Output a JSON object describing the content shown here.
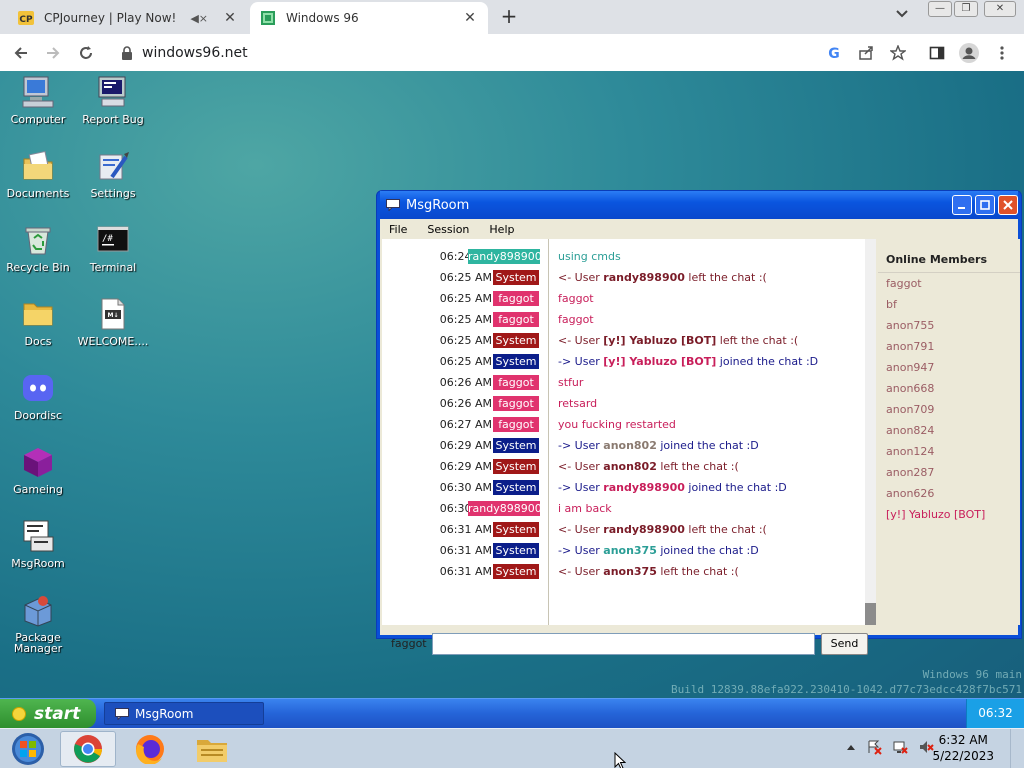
{
  "browser": {
    "tabs": [
      {
        "title": "CPJourney | Play Now!",
        "favicon": "cpjourney-icon",
        "muted": true,
        "active": false
      },
      {
        "title": "Windows 96",
        "favicon": "windows96-icon",
        "active": true
      }
    ],
    "new_tab_label": "+",
    "url": "windows96.net",
    "window_controls": [
      "minimize",
      "restore",
      "close"
    ]
  },
  "desktop": {
    "icons": [
      {
        "label": "Computer",
        "icon": "computer-icon"
      },
      {
        "label": "Report Bug",
        "icon": "report-bug-icon"
      },
      {
        "label": "Documents",
        "icon": "documents-icon"
      },
      {
        "label": "Settings",
        "icon": "settings-icon"
      },
      {
        "label": "Recycle Bin",
        "icon": "recycle-bin-icon"
      },
      {
        "label": "Terminal",
        "icon": "terminal-icon"
      },
      {
        "label": "Docs",
        "icon": "folder-icon"
      },
      {
        "label": "WELCOME....",
        "icon": "markdown-file-icon"
      },
      {
        "label": "Doordisc",
        "icon": "doordisc-icon"
      },
      {
        "label": "Gameing",
        "icon": "gameing-icon"
      },
      {
        "label": "MsgRoom",
        "icon": "msgroom-icon"
      },
      {
        "label": "Package Manager",
        "icon": "package-manager-icon"
      }
    ],
    "watermark_line1": "Windows 96 main",
    "watermark_line2": "Build 12839.88efa922.230410-1042.d77c73edcc428f7bc571"
  },
  "msgroom": {
    "title": "MsgRoom",
    "menu": [
      "File",
      "Session",
      "Help"
    ],
    "messages": [
      {
        "time": "06:24 AM",
        "nick": "randy898900",
        "nick_color": "#2eb5a0",
        "text": "using cmds",
        "kind": "chat-teal"
      },
      {
        "time": "06:25 AM",
        "nick": "System",
        "nick_color": "#a01818",
        "text_prefix": "<- User ",
        "user": "randy898900",
        "text_suffix": " left the chat :(",
        "kind": "sys"
      },
      {
        "time": "06:25 AM",
        "nick": "faggot",
        "nick_color": "#e0336e",
        "text": "faggot",
        "kind": "chat"
      },
      {
        "time": "06:25 AM",
        "nick": "faggot",
        "nick_color": "#e0336e",
        "text": "faggot",
        "kind": "chat"
      },
      {
        "time": "06:25 AM",
        "nick": "System",
        "nick_color": "#a01818",
        "text_prefix": "<- User ",
        "user": "[y!] Yabluzo [BOT]",
        "text_suffix": " left the chat :(",
        "kind": "sys"
      },
      {
        "time": "06:25 AM",
        "nick": "System",
        "nick_color": "#0b1e8a",
        "text_prefix": "-> User ",
        "user": "[y!] Yabluzo [BOT]",
        "user_color": "#c81e5a",
        "text_suffix": " joined the chat :D",
        "kind": "sys"
      },
      {
        "time": "06:26 AM",
        "nick": "faggot",
        "nick_color": "#e0336e",
        "text": "stfur",
        "kind": "chat"
      },
      {
        "time": "06:26 AM",
        "nick": "faggot",
        "nick_color": "#e0336e",
        "text": "retsard",
        "kind": "chat"
      },
      {
        "time": "06:27 AM",
        "nick": "faggot",
        "nick_color": "#e0336e",
        "text": "you fucking restarted",
        "kind": "chat"
      },
      {
        "time": "06:29 AM",
        "nick": "System",
        "nick_color": "#0b1e8a",
        "text_prefix": "-> User ",
        "user": "anon802",
        "user_color": "#8a7a70",
        "text_suffix": " joined the chat :D",
        "kind": "sys"
      },
      {
        "time": "06:29 AM",
        "nick": "System",
        "nick_color": "#a01818",
        "text_prefix": "<- User ",
        "user": "anon802",
        "text_suffix": " left the chat :(",
        "kind": "sys"
      },
      {
        "time": "06:30 AM",
        "nick": "System",
        "nick_color": "#0b1e8a",
        "text_prefix": "-> User ",
        "user": "randy898900",
        "user_color": "#c81e5a",
        "text_suffix": " joined the chat :D",
        "kind": "sys"
      },
      {
        "time": "06:30 AM",
        "nick": "randy898900",
        "nick_color": "#e0336e",
        "text": "i am back",
        "kind": "chat"
      },
      {
        "time": "06:31 AM",
        "nick": "System",
        "nick_color": "#a01818",
        "text_prefix": "<- User ",
        "user": "randy898900",
        "text_suffix": " left the chat :(",
        "kind": "sys"
      },
      {
        "time": "06:31 AM",
        "nick": "System",
        "nick_color": "#0b1e8a",
        "text_prefix": "-> User ",
        "user": "anon375",
        "user_color": "#2b9e96",
        "text_suffix": " joined the chat :D",
        "kind": "sys"
      },
      {
        "time": "06:31 AM",
        "nick": "System",
        "nick_color": "#a01818",
        "text_prefix": "<- User ",
        "user": "anon375",
        "text_suffix": " left the chat :(",
        "kind": "sys"
      }
    ],
    "members_header": "Online Members",
    "members": [
      "faggot",
      "bf",
      "anon755",
      "anon791",
      "anon947",
      "anon668",
      "anon709",
      "anon824",
      "anon124",
      "anon287",
      "anon626",
      "[y!] Yabluzo [BOT]"
    ],
    "nickname": "faggot",
    "input_value": "",
    "send_label": "Send"
  },
  "win96_taskbar": {
    "start_label": "start",
    "tasks": [
      {
        "label": "MsgRoom",
        "icon": "msgroom-icon"
      }
    ],
    "clock": "06:32"
  },
  "win7_taskbar": {
    "pinned": [
      "windows-start-icon",
      "chrome-icon",
      "firefox-icon",
      "file-explorer-icon"
    ],
    "time": "6:32 AM",
    "date": "5/22/2023"
  }
}
